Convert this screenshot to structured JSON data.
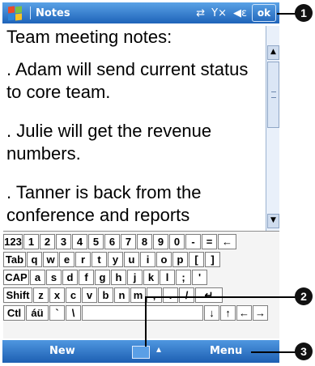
{
  "titlebar": {
    "app_title": "Notes",
    "ok_label": "ok",
    "status_icons": [
      "connectivity-icon",
      "signal-off-icon",
      "volume-icon"
    ]
  },
  "note": {
    "paragraphs": [
      "Team meeting notes:",
      ". Adam will send current status to core team.",
      ". Julie will get the revenue numbers.",
      ". Tanner is back from the conference and reports"
    ]
  },
  "keyboard": {
    "rows": [
      [
        "123",
        "1",
        "2",
        "3",
        "4",
        "5",
        "6",
        "7",
        "8",
        "9",
        "0",
        "-",
        "=",
        "←"
      ],
      [
        "Tab",
        "q",
        "w",
        "e",
        "r",
        "t",
        "y",
        "u",
        "i",
        "o",
        "p",
        "[",
        "]"
      ],
      [
        "CAP",
        "a",
        "s",
        "d",
        "f",
        "g",
        "h",
        "j",
        "k",
        "l",
        ";",
        "'"
      ],
      [
        "Shift",
        "z",
        "x",
        "c",
        "v",
        "b",
        "n",
        "m",
        ",",
        ".",
        "/",
        "↵"
      ],
      [
        "Ctl",
        "áü",
        "`",
        "\\",
        "",
        "↓",
        "↑",
        "←",
        "→"
      ]
    ]
  },
  "menubar": {
    "left_label": "New",
    "right_label": "Menu",
    "input_arrow": "▴"
  },
  "callouts": [
    "1",
    "2",
    "3"
  ]
}
